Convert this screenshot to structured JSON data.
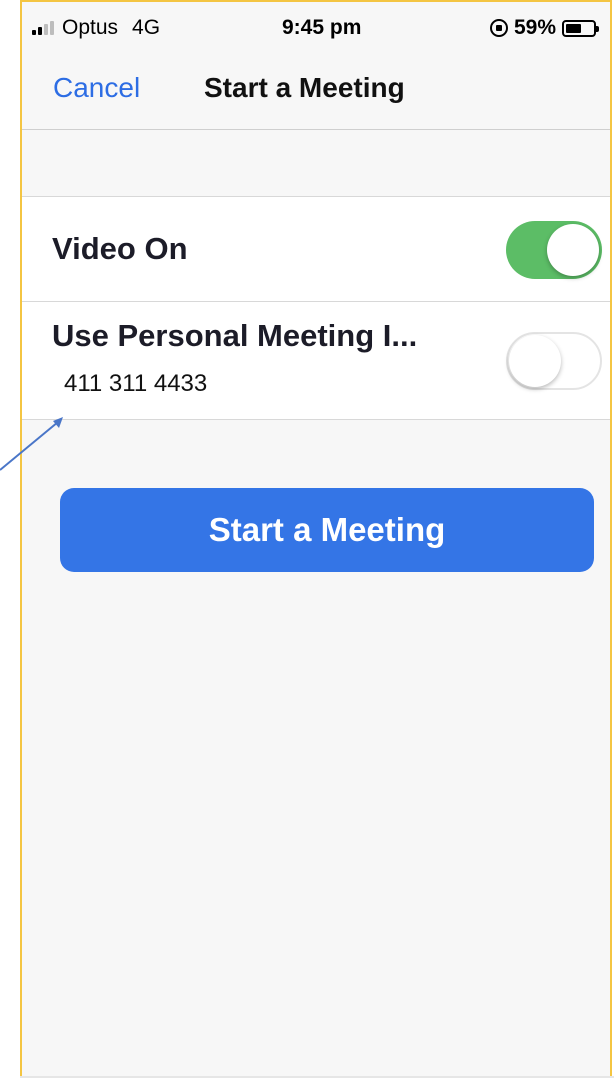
{
  "status_bar": {
    "carrier": "Optus",
    "network": "4G",
    "time": "9:45 pm",
    "battery_percent": "59%",
    "battery_level": 0.59,
    "icons": [
      "signal-icon",
      "orientation-lock-icon",
      "battery-icon"
    ]
  },
  "nav": {
    "cancel_label": "Cancel",
    "title": "Start a Meeting"
  },
  "settings": {
    "video": {
      "label": "Video On",
      "enabled": true
    },
    "pmi": {
      "label": "Use Personal Meeting I...",
      "value": "411 311 4433",
      "enabled": false
    }
  },
  "start_button": {
    "label": "Start a Meeting"
  },
  "colors": {
    "accent": "#2d6de4",
    "button": "#3475e6",
    "toggle_on": "#5cbd66",
    "annotation": "#4a76c8",
    "frame": "#f4c542"
  }
}
